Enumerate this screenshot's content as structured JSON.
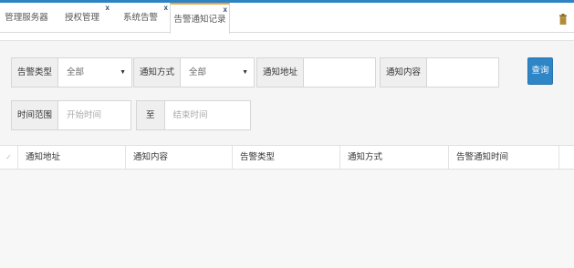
{
  "colors": {
    "accent": "#2d83c3",
    "active_tab_border": "#f2a23a",
    "button": "#2f86c7"
  },
  "tabs": [
    {
      "label": "管理服务器",
      "closable": false,
      "active": false
    },
    {
      "label": "授权管理",
      "closable": true,
      "active": false
    },
    {
      "label": "系统告警",
      "closable": true,
      "active": false
    },
    {
      "label": "告警通知记录",
      "closable": true,
      "active": true
    }
  ],
  "tab_close_glyph": "x",
  "toolbar": {
    "trash_icon": "trash-icon"
  },
  "filters": {
    "alarm_type": {
      "label": "告警类型",
      "value": "全部",
      "caret": "▼"
    },
    "notify_method": {
      "label": "通知方式",
      "value": "全部",
      "caret": "▼"
    },
    "notify_address": {
      "label": "通知地址",
      "value": ""
    },
    "notify_content": {
      "label": "通知内容",
      "value": ""
    },
    "time_range": {
      "label": "时间范围",
      "start_placeholder": "开始时间",
      "to_label": "至",
      "end_placeholder": "结束时间"
    },
    "query_label": "查询"
  },
  "grid": {
    "check_glyph": "✓",
    "columns": [
      "通知地址",
      "通知内容",
      "告警类型",
      "通知方式",
      "告警通知时间"
    ]
  }
}
